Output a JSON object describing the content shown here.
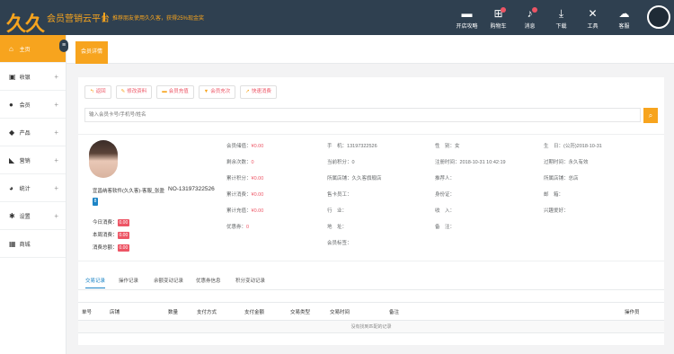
{
  "header": {
    "logo_text": "久久客",
    "platform_name": "会员营销云平台",
    "promo": "推荐朋友使用久久客，获得25%现金奖",
    "icons": [
      {
        "icon": "cashier-icon",
        "label": "开店攻略",
        "badge": false
      },
      {
        "icon": "cart-icon",
        "label": "购物车",
        "badge": true
      },
      {
        "icon": "bell-icon",
        "label": "消息",
        "badge": true
      },
      {
        "icon": "download-icon",
        "label": "下载",
        "badge": false
      },
      {
        "icon": "tools-icon",
        "label": "工具",
        "badge": false
      },
      {
        "icon": "service-icon",
        "label": "客服",
        "badge": false
      }
    ]
  },
  "sidebar": {
    "items": [
      {
        "icon": "home-icon",
        "label": "主页",
        "active": true,
        "expandable": false
      },
      {
        "icon": "register-icon",
        "label": "收银",
        "active": false,
        "expandable": true
      },
      {
        "icon": "user-icon",
        "label": "会员",
        "active": false,
        "expandable": true
      },
      {
        "icon": "box-icon",
        "label": "产品",
        "active": false,
        "expandable": true
      },
      {
        "icon": "tag-icon",
        "label": "营销",
        "active": false,
        "expandable": true
      },
      {
        "icon": "pie-chart-icon",
        "label": "统计",
        "active": false,
        "expandable": true
      },
      {
        "icon": "gear-icon",
        "label": "设置",
        "active": false,
        "expandable": true
      },
      {
        "icon": "shop-icon",
        "label": "商城",
        "active": false,
        "expandable": false
      }
    ]
  },
  "tabs": {
    "active_label": "会员详情"
  },
  "actions": {
    "back": "返回",
    "edit": "修改资料",
    "recharge": "会员充值",
    "times_recharge": "会员充次",
    "quick_consume": "快速消费"
  },
  "search": {
    "placeholder": "输入会员卡号/手机号/姓名"
  },
  "member": {
    "name_line": "宜昌纳客软件(久久客)-客服_张盈",
    "no_line": "NO-13197322526",
    "level_badge": "8",
    "today_label": "今日消费：",
    "today_value": "0.00",
    "week_label": "本周消费：",
    "week_value": "0.00",
    "total_label": "消费总额：",
    "total_value": "0.00"
  },
  "fields": {
    "col1": [
      {
        "label": "会员储值：",
        "value": "¥0.00",
        "red": true
      },
      {
        "label": "剩余次数：",
        "value": "0",
        "red": true
      },
      {
        "label": "累计积分：",
        "value": "¥0.00",
        "red": true
      },
      {
        "label": "累计消费：",
        "value": "¥0.00",
        "red": true
      },
      {
        "label": "累计充值：",
        "value": "¥0.00",
        "red": true
      },
      {
        "label": "优惠券：",
        "value": "0",
        "red": true
      }
    ],
    "col2": [
      {
        "label": "手　机：",
        "value": "13197322526"
      },
      {
        "label": "当前积分：",
        "value": "0"
      },
      {
        "label": "所属店铺：",
        "value": "久久客旗舰店"
      },
      {
        "label": "售卡员工：",
        "value": ""
      },
      {
        "label": "行　业：",
        "value": ""
      },
      {
        "label": "地　址：",
        "value": ""
      },
      {
        "label": "会员标签：",
        "value": ""
      }
    ],
    "col3": [
      {
        "label": "性　别：",
        "value": "女"
      },
      {
        "label": "注册时间：",
        "value": "2018-10-31 10:42:19"
      },
      {
        "label": "推荐人：",
        "value": ""
      },
      {
        "label": "身份证：",
        "value": ""
      },
      {
        "label": "收　入：",
        "value": ""
      },
      {
        "label": "备　注：",
        "value": ""
      }
    ],
    "col4": [
      {
        "label": "生　日：",
        "value": "(公历)2018-10-31"
      },
      {
        "label": "过期时间：",
        "value": "永久有效"
      },
      {
        "label": "所属店铺：",
        "value": "总店"
      },
      {
        "label": "邮　箱：",
        "value": ""
      },
      {
        "label": "兴趣爱好：",
        "value": ""
      }
    ]
  },
  "records": {
    "tabs": [
      "交易记录",
      "操作记录",
      "余额变动记录",
      "优惠券信息",
      "积分变动记录"
    ],
    "columns": [
      "单号",
      "店铺",
      "数量",
      "支付方式",
      "支付金额",
      "交易类型",
      "交易时间",
      "备注",
      "操作员"
    ],
    "empty_text": "没有找到匹配的记录"
  },
  "colors": {
    "accent": "#f7a41e",
    "header": "#2f4050",
    "danger": "#ed5565",
    "link": "#1c84c6"
  }
}
